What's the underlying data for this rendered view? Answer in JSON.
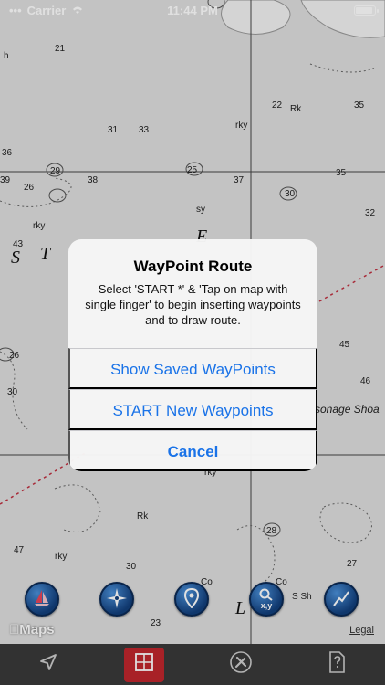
{
  "status_bar": {
    "carrier": "Carrier",
    "time": "11:44 PM"
  },
  "chart_labels": {
    "depths": [
      "21",
      "31",
      "33",
      "36",
      "29",
      "26",
      "38",
      "37",
      "35",
      "39",
      "30",
      "43",
      "45",
      "32",
      "22",
      "28",
      "30",
      "25",
      "27"
    ],
    "big_letters": [
      "S",
      "T",
      "E",
      "L"
    ],
    "place": "sonage Shoa",
    "small": [
      "sy",
      "rky",
      "Rk",
      "Co",
      "S Sh",
      "h"
    ]
  },
  "alert": {
    "title": "WayPoint Route",
    "message": "Select 'START *' & 'Tap on map with single finger' to begin inserting waypoints and to draw route.",
    "buttons": {
      "show_saved": "Show Saved WayPoints",
      "start_new": "START New Waypoints",
      "cancel": "Cancel"
    }
  },
  "map_tools": {
    "coords_label": "x,y",
    "maps_logo": "Maps",
    "legal": "Legal"
  },
  "colors": {
    "accent": "#1a73e8",
    "tab_bar": "#3a3a3a",
    "active_tab": "#c0262d",
    "tool_blue": "#123f7c"
  },
  "icons": {
    "tools": [
      "sailboat-icon",
      "compass-icon",
      "location-pin-icon",
      "search-coordinates-icon",
      "route-icon"
    ],
    "tabs": [
      "navigation-arrow-icon",
      "grid-layers-icon",
      "tools-icon",
      "document-help-icon"
    ]
  }
}
